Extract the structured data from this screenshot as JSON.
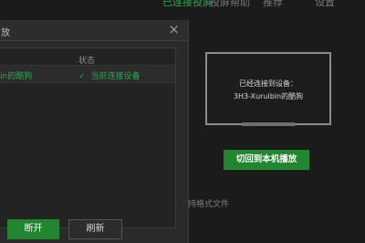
{
  "top_menu": [
    "已连接投屏",
    "投屏帮助",
    "推荐",
    "设置"
  ],
  "dialog": {
    "title": "放",
    "close_icon": "close-icon",
    "table": {
      "headers": {
        "status": "状态"
      },
      "rows": [
        {
          "device": "in的酷狗",
          "status": "当前连接设备"
        }
      ]
    },
    "buttons": {
      "disconnect": "断开",
      "refresh": "刷新"
    }
  },
  "cast_panel": {
    "line1": "已经连接到设备：",
    "line2": "3H3-Xuruibin的酷狗",
    "switch_button": "切回到本机播放",
    "format_hint": "持格式文件"
  },
  "colors": {
    "accent": "#21862f",
    "accent_text": "#2fa84f",
    "background": "#1b1b1b",
    "dialog": "#2a2a2a"
  }
}
